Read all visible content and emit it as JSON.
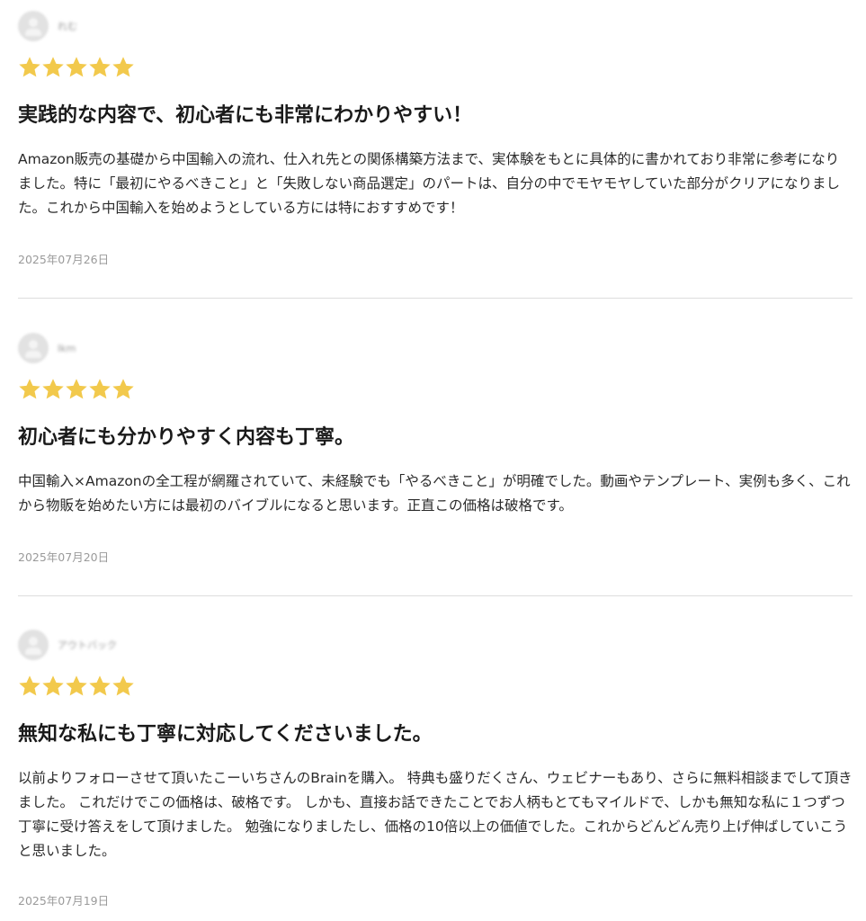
{
  "colors": {
    "star": "#f2c94c",
    "divider": "#dddddd",
    "date": "#9a9a9a"
  },
  "reviews": [
    {
      "reviewer": "れむ",
      "rating": 5,
      "title": "実践的な内容で、初心者にも非常にわかりやすい！",
      "body": "Amazon販売の基礎から中国輸入の流れ、仕入れ先との関係構築方法まで、実体験をもとに具体的に書かれており非常に参考になりました。特に「最初にやるべきこと」と「失敗しない商品選定」のパートは、自分の中でモヤモヤしていた部分がクリアになりました。これから中国輸入を始めようとしている方には特におすすめです！",
      "date": "2025年07月26日"
    },
    {
      "reviewer": "Ikm",
      "rating": 5,
      "title": "初心者にも分かりやすく内容も丁寧。",
      "body": "中国輸入×Amazonの全工程が網羅されていて、未経験でも「やるべきこと」が明確でした。動画やテンプレート、実例も多く、これから物販を始めたい方には最初のバイブルになると思います。正直この価格は破格です。",
      "date": "2025年07月20日"
    },
    {
      "reviewer": "アウトバック",
      "rating": 5,
      "title": "無知な私にも丁寧に対応してくださいました。",
      "body": "以前よりフォローさせて頂いたこーいちさんのBrainを購入。 特典も盛りだくさん、ウェビナーもあり、さらに無料相談までして頂きました。 これだけでこの価格は、破格です。 しかも、直接お話できたことでお人柄もとてもマイルドで、しかも無知な私に１つずつ丁寧に受け答えをして頂けました。 勉強になりましたし、価格の10倍以上の価値でした。これからどんどん売り上げ伸ばしていこうと思いました。",
      "date": "2025年07月19日"
    }
  ]
}
